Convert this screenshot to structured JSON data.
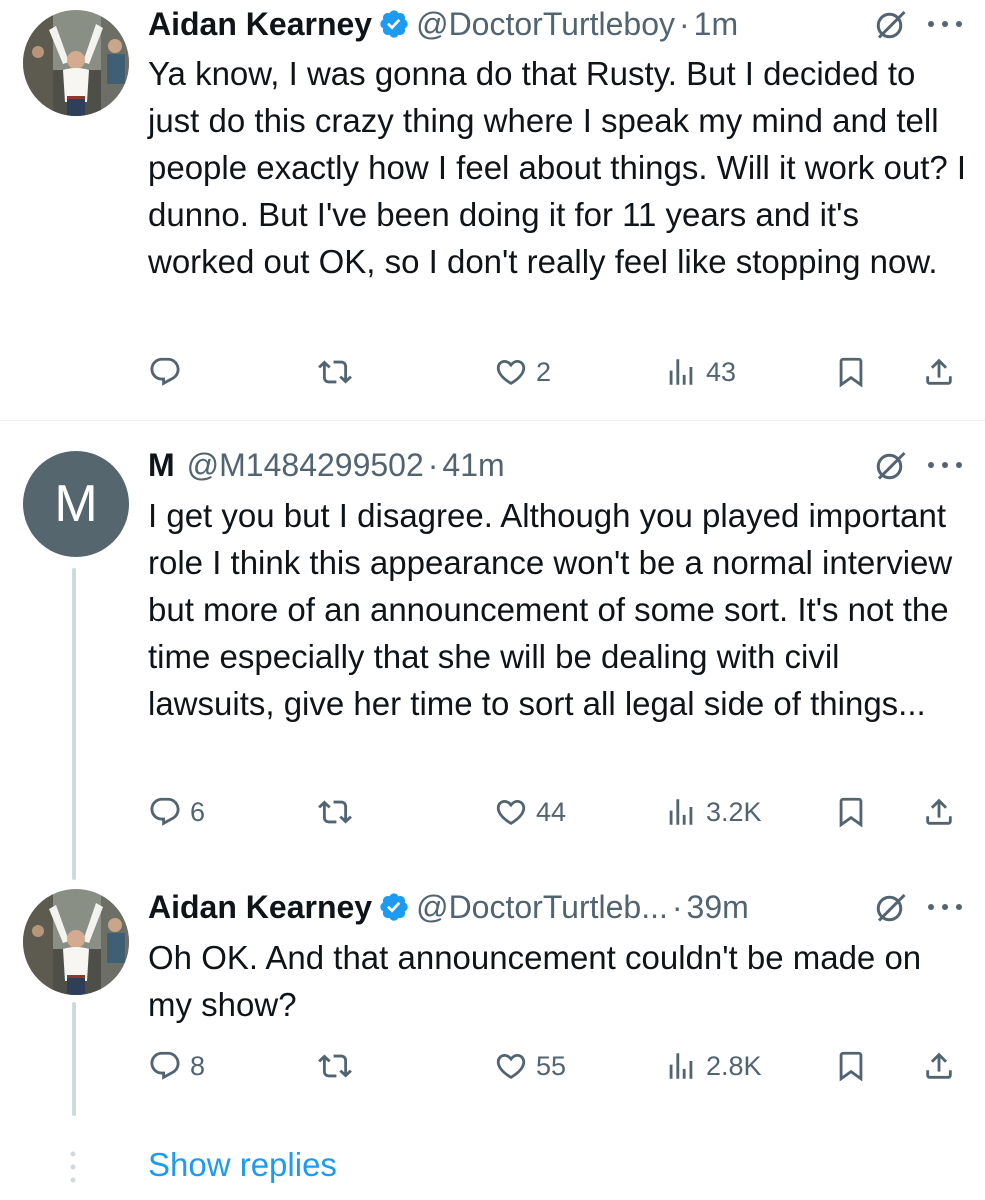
{
  "colors": {
    "accent": "#1d9bf0",
    "secondary_text": "#536471",
    "primary_text": "#0f1419",
    "thread_line": "#cfd9de",
    "avatar_letter_bg": "#56666f"
  },
  "tweets": [
    {
      "name": "Aidan Kearney",
      "verified": true,
      "handle": "@DoctorTurtleboy",
      "separator": "·",
      "time": "1m",
      "text": "Ya know, I was gonna do that Rusty. But I decided to just do this crazy thing where I speak my mind and tell people exactly how I feel about things. Will it work out? I dunno. But I've been doing it for 11 years and it's worked out OK, so I don't really feel like stopping now.",
      "avatar": {
        "type": "photo",
        "icon": "profile-photo"
      },
      "actions": {
        "replies": "",
        "retweets": "",
        "likes": "2",
        "views": "43"
      }
    },
    {
      "name": "M",
      "verified": false,
      "handle": "@M1484299502",
      "separator": "·",
      "time": "41m",
      "text": "I get you but I disagree. Although you played important role I think this appearance won't be a normal interview but more of an announcement of some sort. It's not the time especially that she will be dealing with civil lawsuits, give her time to sort all legal side of things...",
      "avatar": {
        "type": "letter",
        "letter": "M"
      },
      "actions": {
        "replies": "6",
        "retweets": "",
        "likes": "44",
        "views": "3.2K"
      }
    },
    {
      "name": "Aidan Kearney",
      "verified": true,
      "handle": "@DoctorTurtleb...",
      "separator": "·",
      "time": "39m",
      "text": "Oh OK. And that announcement couldn't be made on my show?",
      "avatar": {
        "type": "photo",
        "icon": "profile-photo"
      },
      "actions": {
        "replies": "8",
        "retweets": "",
        "likes": "55",
        "views": "2.8K"
      }
    }
  ],
  "show_replies_label": "Show replies"
}
